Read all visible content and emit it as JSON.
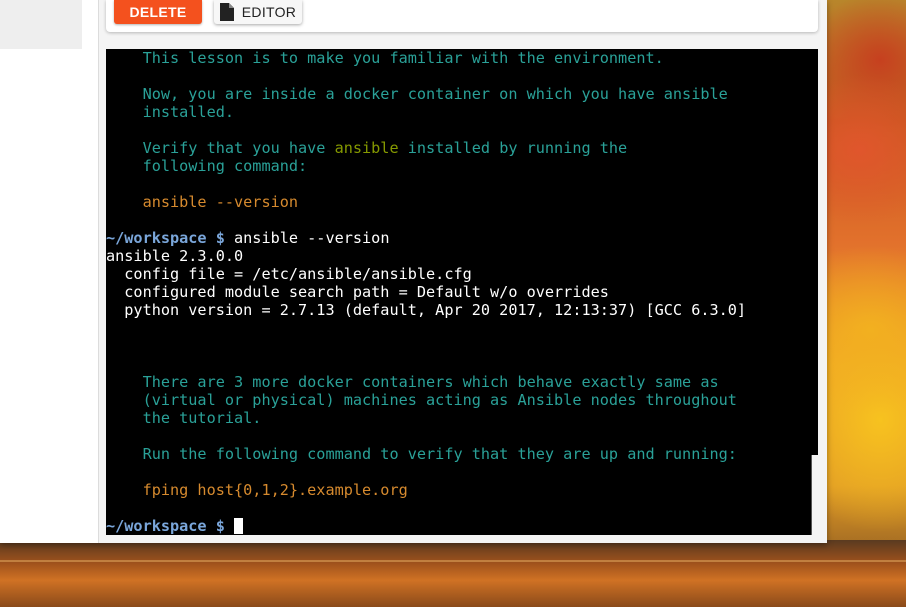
{
  "toolbar": {
    "delete_label": "DELETE",
    "editor_label": "EDITOR",
    "editor_icon": "file-icon"
  },
  "terminal": {
    "prompt": "~/workspace $",
    "lines": [
      {
        "kind": "info",
        "text": "    This lesson is to make you familiar with the environment."
      },
      {
        "kind": "blank",
        "text": ""
      },
      {
        "kind": "info",
        "text": "    Now, you are inside a docker container on which you have ansible"
      },
      {
        "kind": "info",
        "text": "    installed."
      },
      {
        "kind": "blank",
        "text": ""
      },
      {
        "kind": "info_hl",
        "pre": "    Verify that you have ",
        "hl": "ansible",
        "post": " installed by running the"
      },
      {
        "kind": "info",
        "text": "    following command:"
      },
      {
        "kind": "blank",
        "text": ""
      },
      {
        "kind": "cmd",
        "text": "    ansible --version"
      },
      {
        "kind": "blank",
        "text": ""
      },
      {
        "kind": "prompt",
        "text": " ansible --version"
      },
      {
        "kind": "out",
        "text": "ansible 2.3.0.0"
      },
      {
        "kind": "out",
        "text": "  config file = /etc/ansible/ansible.cfg"
      },
      {
        "kind": "out",
        "text": "  configured module search path = Default w/o overrides"
      },
      {
        "kind": "out",
        "text": "  python version = 2.7.13 (default, Apr 20 2017, 12:13:37) [GCC 6.3.0]"
      },
      {
        "kind": "blank",
        "text": ""
      },
      {
        "kind": "blank",
        "text": ""
      },
      {
        "kind": "blank",
        "text": ""
      },
      {
        "kind": "info",
        "text": "    There are 3 more docker containers which behave exactly same as"
      },
      {
        "kind": "info",
        "text": "    (virtual or physical) machines acting as Ansible nodes throughout"
      },
      {
        "kind": "info",
        "text": "    the tutorial."
      },
      {
        "kind": "blank",
        "text": ""
      },
      {
        "kind": "info",
        "text": "    Run the following command to verify that they are up and running:"
      },
      {
        "kind": "blank",
        "text": ""
      },
      {
        "kind": "cmd",
        "text": "    fping host{0,1,2}.example.org"
      },
      {
        "kind": "blank",
        "text": ""
      },
      {
        "kind": "prompt_cursor",
        "text": " "
      }
    ]
  },
  "colors": {
    "delete_button": "#f4511e",
    "info_text": "#2aa198",
    "highlight_text": "#859900",
    "command_text": "#d68a2e",
    "prompt_text": "#7aa6da",
    "terminal_bg": "#000000"
  }
}
